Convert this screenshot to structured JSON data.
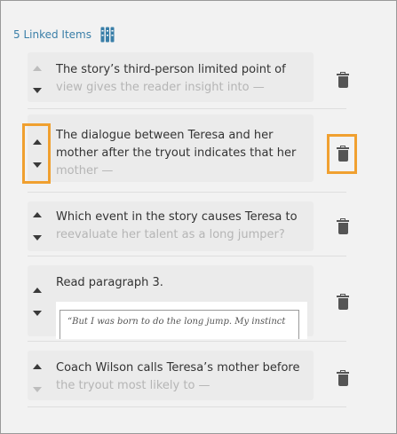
{
  "header": {
    "label": "5 Linked Items",
    "icon": "columns-icon",
    "accent": "#3a7fa8"
  },
  "highlight_color": "#f0a030",
  "items": [
    {
      "line1": "The story’s third-person limited point of",
      "line2": "view gives the reader insight into —",
      "up_enabled": false,
      "down_enabled": true
    },
    {
      "line1": "The dialogue between Teresa and her",
      "line2": "mother after the tryout indicates that her",
      "line3": "mother —",
      "up_enabled": true,
      "down_enabled": true
    },
    {
      "line1": "Which event in the story causes Teresa to",
      "line2": "reevaluate her talent as a long jumper?",
      "up_enabled": true,
      "down_enabled": true
    },
    {
      "line1": "Read paragraph 3.",
      "quote_line1": "“But I was born to do the long jump. My instinct",
      "quote_line2": "",
      "up_enabled": true,
      "down_enabled": true
    },
    {
      "line1": "Coach Wilson calls Teresa’s mother before",
      "line2": "the tryout most likely to —",
      "up_enabled": true,
      "down_enabled": false
    }
  ]
}
